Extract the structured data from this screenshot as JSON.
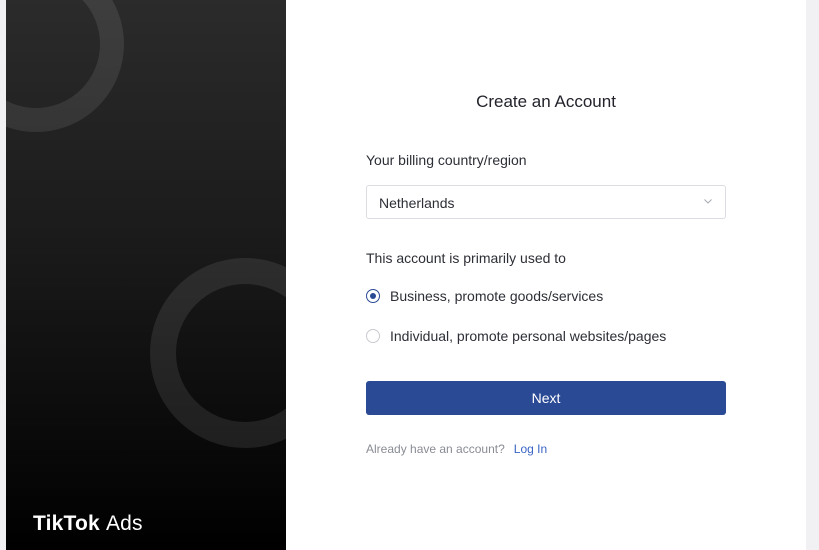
{
  "brand": {
    "name_main": "TikTok",
    "name_sub": "Ads"
  },
  "form": {
    "title": "Create an Account",
    "country_label": "Your billing country/region",
    "country_value": "Netherlands",
    "purpose_label": "This account is primarily used to",
    "options": [
      {
        "label": "Business, promote goods/services",
        "selected": true
      },
      {
        "label": "Individual, promote personal websites/pages",
        "selected": false
      }
    ],
    "next_label": "Next",
    "login_prompt": "Already have an account?",
    "login_link": "Log In"
  },
  "colors": {
    "primary": "#2b4a95",
    "link": "#3a64c4",
    "panel_dark": "#000000"
  },
  "icons": {
    "select_chevron": "chevron-down-icon"
  }
}
